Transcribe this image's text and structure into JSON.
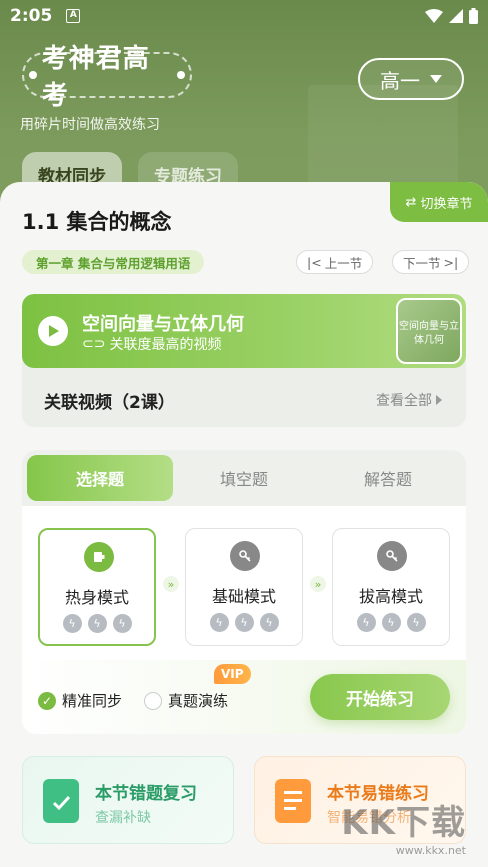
{
  "status_bar": {
    "time": "2:05",
    "notification_letter": "A"
  },
  "header": {
    "logo_text": "考神君高考",
    "slogan": "用碎片时间做高效练习",
    "grade_selected": "高一",
    "bg_tabs": [
      "教材同步",
      "专题练习"
    ]
  },
  "sheet": {
    "switch_chapter_label": "切换章节",
    "section_title": "1.1 集合的概念",
    "chapter_label": "第一章 集合与常用逻辑用语",
    "prev_label": "上一节",
    "next_label": "下一节",
    "video": {
      "title": "空间向量与立体几何",
      "subtitle": "关联度最高的视频",
      "thumb_text": "空间向量与立体几何"
    },
    "related": {
      "label": "关联视频（2课）",
      "view_all": "查看全部"
    },
    "practice_tabs": [
      "选择题",
      "填空题",
      "解答题"
    ],
    "modes": [
      {
        "label": "热身模式"
      },
      {
        "label": "基础模式"
      },
      {
        "label": "拔高模式"
      }
    ],
    "options": {
      "precise_sync": "精准同步",
      "real_exam": "真题演练",
      "vip_badge": "VIP"
    },
    "start_button": "开始练习",
    "promos": [
      {
        "title": "本节错题复习",
        "subtitle": "查漏补缺"
      },
      {
        "title": "本节易错练习",
        "subtitle": "智能易错分析"
      }
    ]
  },
  "watermark": {
    "brand": "KK下载",
    "url": "www.kkx.net"
  },
  "colors": {
    "accent": "#7cbb42",
    "orange": "#ff9b3c",
    "teal": "#3fbf84"
  }
}
